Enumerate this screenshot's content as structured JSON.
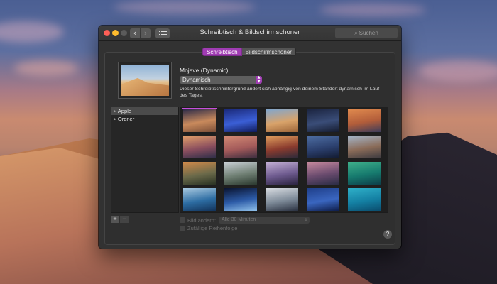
{
  "window": {
    "title": "Schreibtisch & Bildschirmschoner"
  },
  "search": {
    "placeholder": "Suchen"
  },
  "tabs": [
    {
      "label": "Schreibtisch",
      "active": true
    },
    {
      "label": "Bildschirmschoner",
      "active": false
    }
  ],
  "wallpaper": {
    "name": "Mojave (Dynamic)",
    "mode": "Dynamisch",
    "description": "Dieser Schreibtischhintergrund ändert sich abhängig von deinem Standort dynamisch im Lauf des Tages."
  },
  "sidebar": {
    "items": [
      {
        "label": "Apple",
        "selected": true
      },
      {
        "label": "Ordner",
        "selected": false
      }
    ]
  },
  "thumbnails": [
    {
      "name": "mojave-dynamic",
      "colors": [
        "#2b2a48",
        "#c98a5c",
        "#7a4e38"
      ],
      "selected": true
    },
    {
      "name": "solid-blue",
      "colors": [
        "#1b2a7a",
        "#3b5fd6",
        "#0f1a5a"
      ],
      "selected": false
    },
    {
      "name": "mojave-day",
      "colors": [
        "#7fa6cf",
        "#d9a36a",
        "#9c6438"
      ],
      "selected": false
    },
    {
      "name": "mojave-night",
      "colors": [
        "#1b2440",
        "#3a4d78",
        "#151b2e"
      ],
      "selected": false
    },
    {
      "name": "high-sierra",
      "colors": [
        "#e08a4e",
        "#b25d3a",
        "#3c3c5a"
      ],
      "selected": false
    },
    {
      "name": "sierra",
      "colors": [
        "#e3a06a",
        "#8a4e5e",
        "#2d2d48"
      ],
      "selected": false
    },
    {
      "name": "el-capitan-dusk",
      "colors": [
        "#d38a74",
        "#a35a5a",
        "#3b2d3f"
      ],
      "selected": false
    },
    {
      "name": "mountain-sunset",
      "colors": [
        "#e2a05e",
        "#8a3b2e",
        "#2a2a3a"
      ],
      "selected": false
    },
    {
      "name": "lake-twilight",
      "colors": [
        "#4e6ea3",
        "#2b3f6d",
        "#121a30"
      ],
      "selected": false
    },
    {
      "name": "el-capitan",
      "colors": [
        "#a5b6c9",
        "#8a6b58",
        "#3d3b40"
      ],
      "selected": false
    },
    {
      "name": "yosemite-valley",
      "colors": [
        "#d18a4a",
        "#6b6a4a",
        "#2a3324"
      ],
      "selected": false
    },
    {
      "name": "yosemite-forest",
      "colors": [
        "#c9d0d6",
        "#6f7f73",
        "#2c3a30"
      ],
      "selected": false
    },
    {
      "name": "half-dome",
      "colors": [
        "#c5b1d6",
        "#6e5b8f",
        "#2b2340"
      ],
      "selected": false
    },
    {
      "name": "lake-dusk",
      "colors": [
        "#c78a9e",
        "#6a4b6e",
        "#2b2c45"
      ],
      "selected": false
    },
    {
      "name": "wave-green",
      "colors": [
        "#3fb08a",
        "#167a6e",
        "#0d3f4a"
      ],
      "selected": false
    },
    {
      "name": "wave-blue",
      "colors": [
        "#a8c9e0",
        "#2d6da3",
        "#13335a"
      ],
      "selected": false
    },
    {
      "name": "earth-horizon",
      "colors": [
        "#0a1430",
        "#2d5ca8",
        "#8fc0ea"
      ],
      "selected": false
    },
    {
      "name": "earth-from-space",
      "colors": [
        "#d9dde2",
        "#7d8a98",
        "#2a3140"
      ],
      "selected": false
    },
    {
      "name": "galaxy",
      "colors": [
        "#1f3f8a",
        "#3a66c0",
        "#0e1d4a"
      ],
      "selected": false
    },
    {
      "name": "water-ripple",
      "colors": [
        "#2fb0c9",
        "#1480a3",
        "#0b4d6e"
      ],
      "selected": false
    }
  ],
  "options": {
    "change_picture_label": "Bild ändern:",
    "interval": "Alle 30 Minuten",
    "random_order_label": "Zufällige Reihenfolge"
  },
  "buttons": {
    "add": "+",
    "remove": "−",
    "help": "?"
  },
  "colors": {
    "accent": "#a03cb3",
    "window_bg": "#323232"
  }
}
